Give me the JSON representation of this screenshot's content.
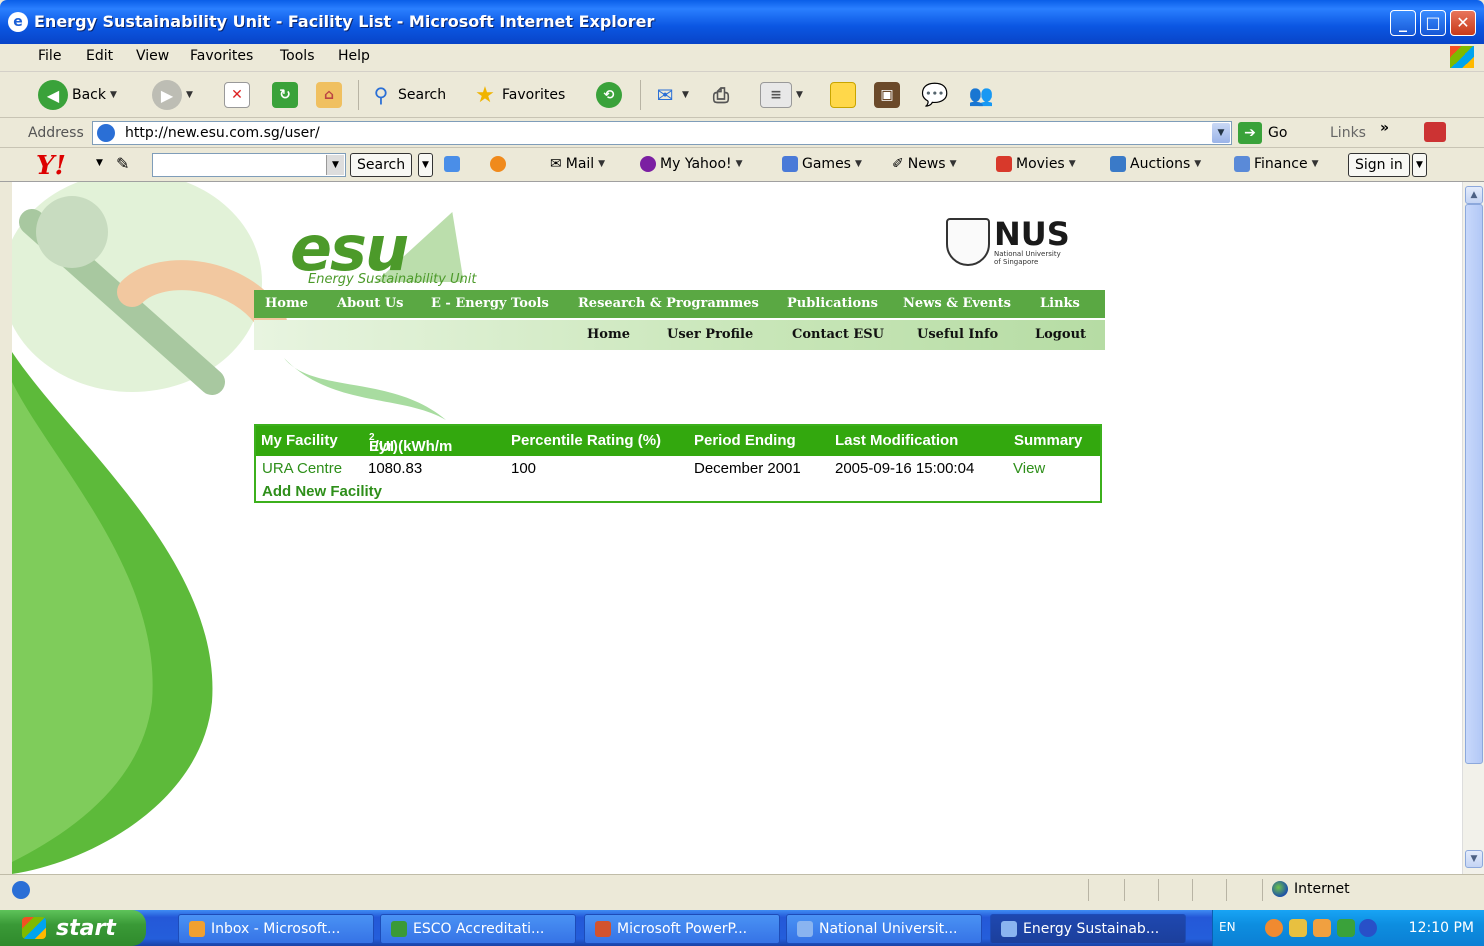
{
  "window": {
    "title": "Energy Sustainability Unit - Facility List - Microsoft Internet Explorer"
  },
  "menu": [
    "File",
    "Edit",
    "View",
    "Favorites",
    "Tools",
    "Help"
  ],
  "toolbar": {
    "back": "Back",
    "search": "Search",
    "favorites": "Favorites"
  },
  "address": {
    "label": "Address",
    "url": "http://new.esu.com.sg/user/",
    "go": "Go",
    "links": "Links"
  },
  "yahoo": {
    "search_btn": "Search",
    "mail": "Mail",
    "my_yahoo": "My Yahoo!",
    "games": "Games",
    "news": "News",
    "movies": "Movies",
    "auctions": "Auctions",
    "finance": "Finance",
    "sign_in": "Sign in"
  },
  "site": {
    "logo": "esu",
    "logo_sub": "Energy Sustainability Unit",
    "nus": "NUS",
    "nus_sub1": "National University",
    "nus_sub2": "of Singapore",
    "nav_main": [
      "Home",
      "About Us",
      "E - Energy Tools",
      "Research & Programmes",
      "Publications",
      "News & Events",
      "Links"
    ],
    "nav_user": [
      "Home",
      "User Profile",
      "Contact ESU",
      "Useful Info",
      "Logout"
    ]
  },
  "facility_table": {
    "headers": {
      "facility": "My Facility",
      "eui_pre": "EUI (kWh/m",
      "eui_sup": "2",
      "eui_post": "/yr)",
      "percentile": "Percentile Rating (%)",
      "period": "Period Ending",
      "modified": "Last Modification",
      "summary": "Summary"
    },
    "rows": [
      {
        "facility": "URA Centre",
        "eui": "1080.83",
        "percentile": "100",
        "period": "December 2001",
        "modified": "2005-09-16 15:00:04",
        "summary": "View"
      }
    ],
    "add_link": "Add New Facility"
  },
  "status": {
    "zone": "Internet"
  },
  "taskbar": {
    "start": "start",
    "tasks": [
      "Inbox - Microsoft...",
      "ESCO Accreditati...",
      "Microsoft PowerP...",
      "National Universit...",
      "Energy Sustainab..."
    ],
    "lang": "EN",
    "clock": "12:10 PM"
  },
  "colors": {
    "accent_green": "#33a80e",
    "nav_green": "#5aa843",
    "link_green": "#2e8f1a",
    "xp_blue": "#0b56e2"
  }
}
